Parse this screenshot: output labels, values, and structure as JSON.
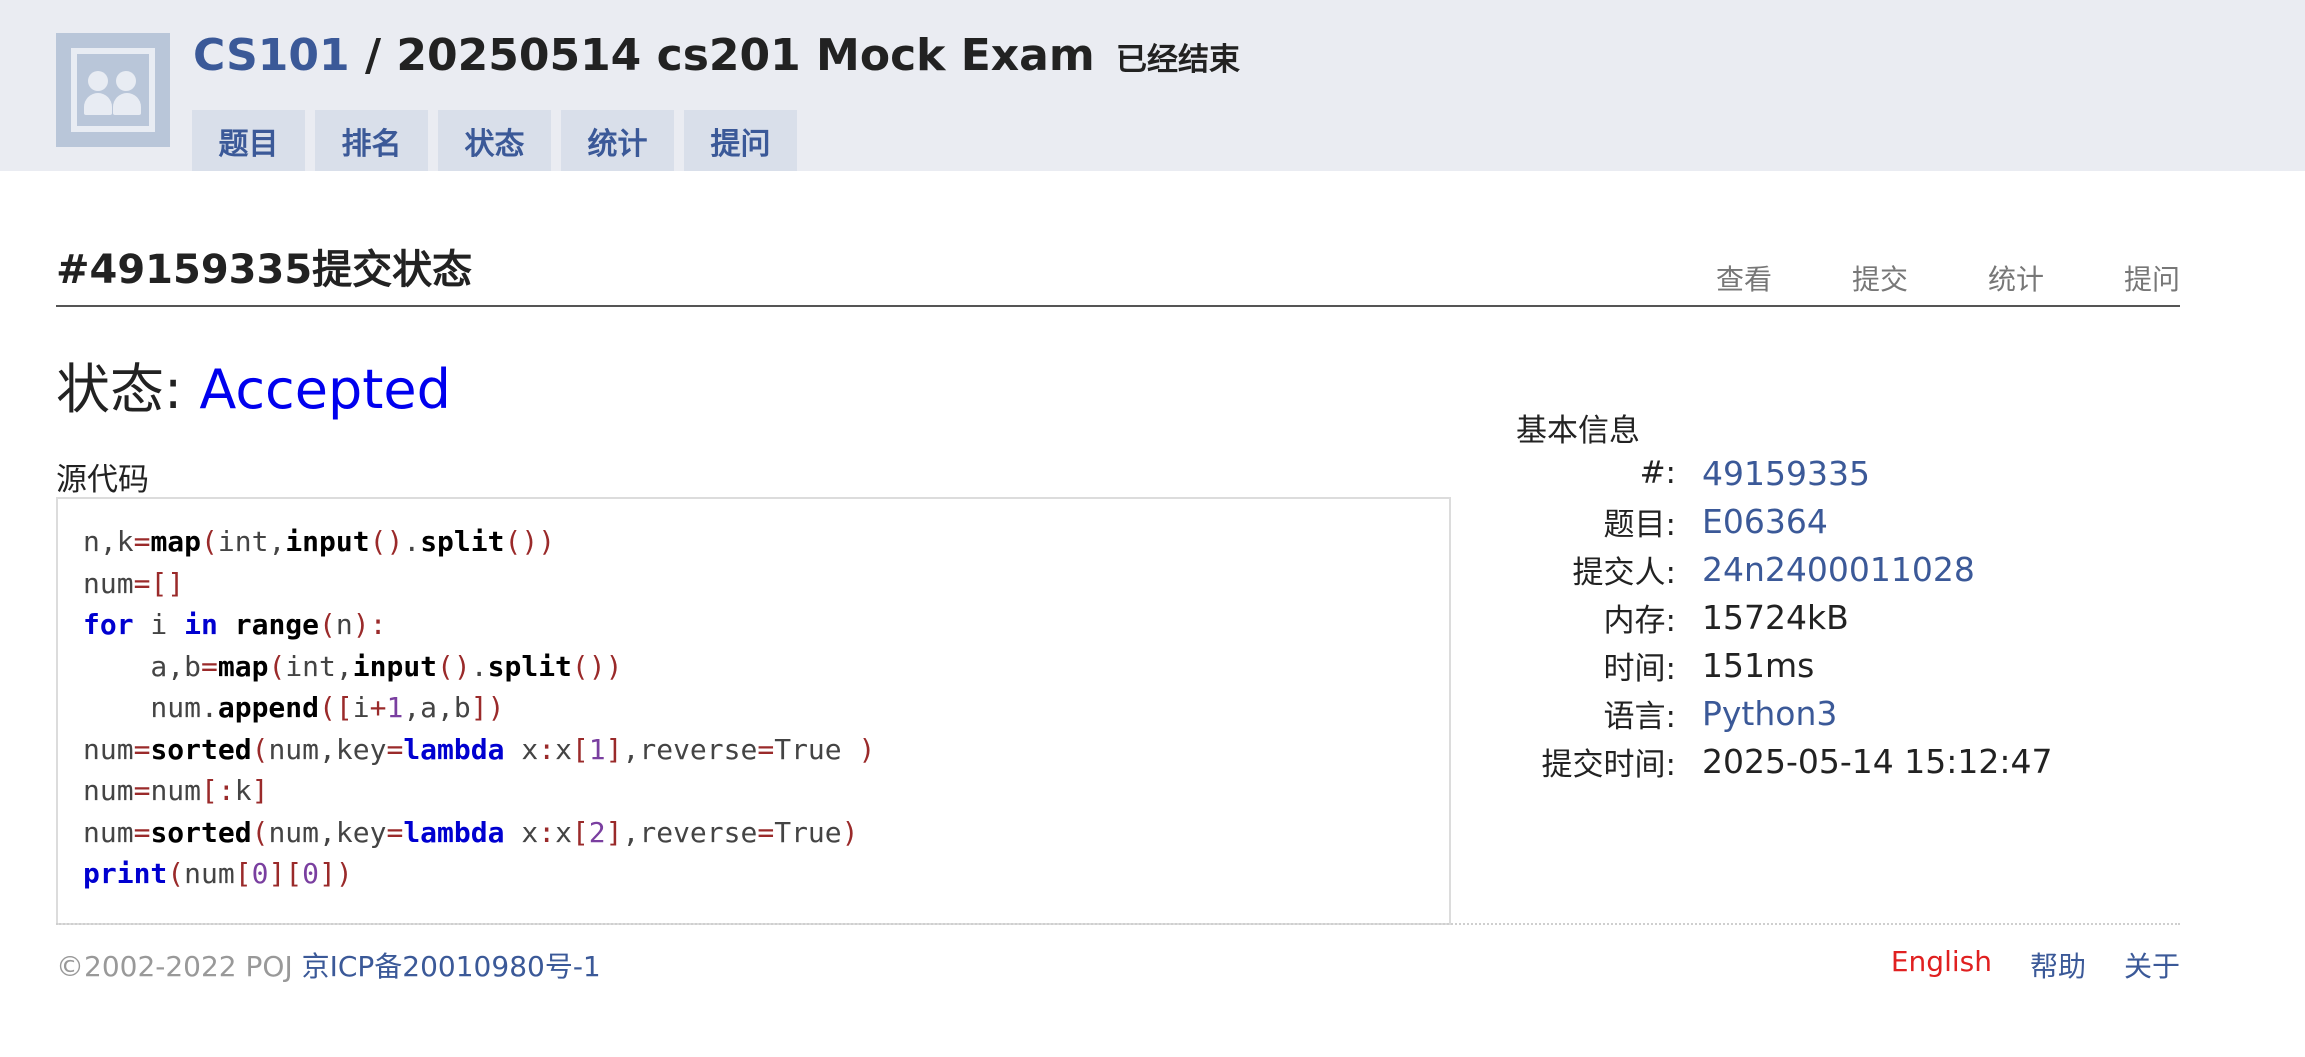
{
  "header": {
    "course": "CS101",
    "separator": " / ",
    "contest_name": "20250514 cs201 Mock Exam",
    "contest_status": "已经结束",
    "tabs": [
      {
        "label": "题目"
      },
      {
        "label": "排名"
      },
      {
        "label": "状态"
      },
      {
        "label": "统计"
      },
      {
        "label": "提问"
      }
    ]
  },
  "page": {
    "title": "#49159335提交状态",
    "sub_links": [
      {
        "label": "查看"
      },
      {
        "label": "提交"
      },
      {
        "label": "统计"
      },
      {
        "label": "提问"
      }
    ]
  },
  "status": {
    "label": "状态: ",
    "value": "Accepted"
  },
  "source": {
    "label": "源代码",
    "code_lines": [
      "n,k=map(int,input().split())",
      "num=[]",
      "for i in range(n):",
      "    a,b=map(int,input().split())",
      "    num.append([i+1,a,b])",
      "num=sorted(num,key=lambda x:x[1],reverse=True )",
      "num=num[:k]",
      "num=sorted(num,key=lambda x:x[2],reverse=True)",
      "print(num[0][0])"
    ]
  },
  "info": {
    "heading": "基本信息",
    "rows": [
      {
        "key": "#:",
        "value": "49159335",
        "link": true
      },
      {
        "key": "题目:",
        "value": "E06364",
        "link": true
      },
      {
        "key": "提交人:",
        "value": "24n2400011028",
        "link": true
      },
      {
        "key": "内存:",
        "value": "15724kB",
        "link": false
      },
      {
        "key": "时间:",
        "value": "151ms",
        "link": false
      },
      {
        "key": "语言:",
        "value": "Python3",
        "link": true
      },
      {
        "key": "提交时间:",
        "value": "2025-05-14 15:12:47",
        "link": false
      }
    ]
  },
  "footer": {
    "copyright": "©2002-2022 POJ ",
    "icp": "京ICP备20010980号-1",
    "links": [
      {
        "label": "English"
      },
      {
        "label": "帮助"
      },
      {
        "label": "关于"
      }
    ]
  },
  "colors": {
    "header_bg": "#eaecf2",
    "tab_bg": "#d9dfea",
    "link": "#3b5998",
    "accepted": "#0000ee",
    "english_link": "#e02020"
  },
  "icons": {
    "logo": "user-group-placeholder-icon"
  }
}
